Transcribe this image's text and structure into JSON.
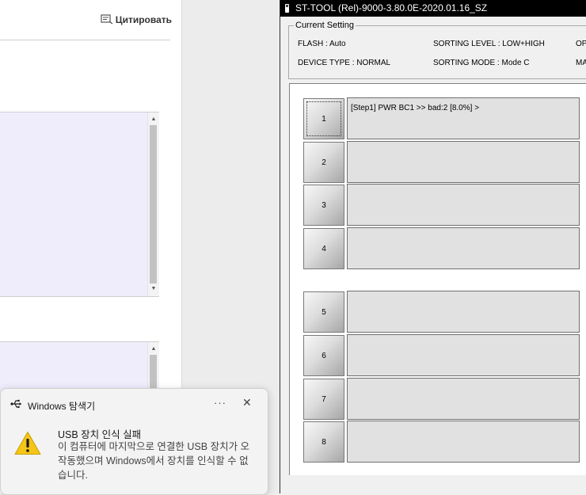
{
  "browser": {
    "cite_label": "Цитировать"
  },
  "app": {
    "title": "ST-TOOL (Rel)-9000-3.80.0E-2020.01.16_SZ",
    "current_setting": {
      "legend": "Current Setting",
      "flash": "FLASH : Auto",
      "device_type": "DEVICE TYPE : NORMAL",
      "sorting_level": "SORTING LEVEL : LOW+HIGH",
      "sorting_mode": "SORTING MODE : Mode C",
      "option_partial": "OP",
      "mode_partial": "MA"
    },
    "steps": [
      {
        "button": "1",
        "text": "[Step1] PWR BC1  >> bad:2  [8.0%] >"
      },
      {
        "button": "2",
        "text": ""
      },
      {
        "button": "3",
        "text": ""
      },
      {
        "button": "4",
        "text": ""
      },
      {
        "button": "5",
        "text": ""
      },
      {
        "button": "6",
        "text": ""
      },
      {
        "button": "7",
        "text": ""
      },
      {
        "button": "8",
        "text": ""
      }
    ]
  },
  "toast": {
    "app_name": "Windows 탐색기",
    "more": "···",
    "close": "✕",
    "title": "USB 장치 인식 실패",
    "body": "이 컴퓨터에 마지막으로 연결한 USB 장치가 오작동했으며 Windows에서 장치를 인식할 수 없습니다.",
    "warning_icon": "warning-icon",
    "warning_color": "#f5c518"
  }
}
